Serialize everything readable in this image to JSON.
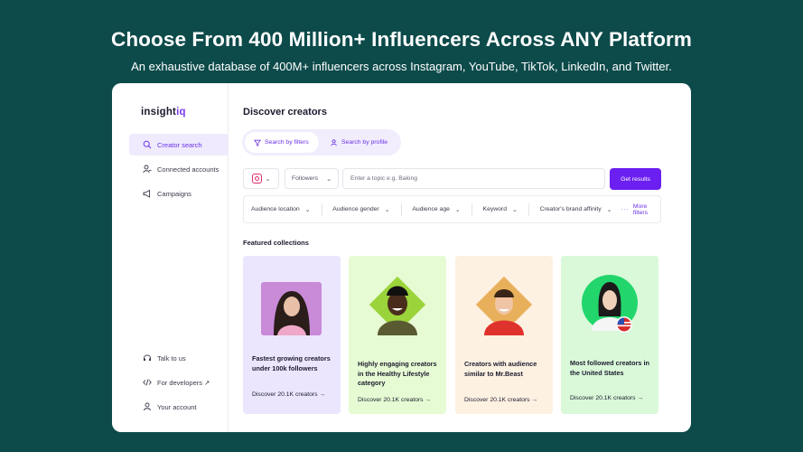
{
  "hero": {
    "title": "Choose From 400 Million+ Influencers Across ANY Platform",
    "subtitle": "An exhaustive database of 400M+ influencers across Instagram, YouTube, TikTok, LinkedIn, and Twitter."
  },
  "brand": {
    "logo_main": "insight",
    "logo_accent": "iq",
    "accent_color": "#6b1ff0"
  },
  "sidebar": {
    "items": [
      {
        "label": "Creator search",
        "icon": "search-icon",
        "active": true
      },
      {
        "label": "Connected accounts",
        "icon": "user-link-icon",
        "active": false
      },
      {
        "label": "Campaigns",
        "icon": "megaphone-icon",
        "active": false
      }
    ],
    "bottom_items": [
      {
        "label": "Talk to us",
        "icon": "headset-icon"
      },
      {
        "label": "For developers ↗",
        "icon": "code-icon"
      },
      {
        "label": "Your account",
        "icon": "user-icon"
      }
    ]
  },
  "main": {
    "title": "Discover creators",
    "tabs": [
      {
        "label": "Search by filters",
        "icon": "filter-icon",
        "active": true
      },
      {
        "label": "Search by profile",
        "icon": "profile-search-icon",
        "active": false
      }
    ],
    "search": {
      "platform_icon": "instagram-icon",
      "metric": "Followers",
      "placeholder": "Enter a topic e.g. Baking",
      "button": "Get results"
    },
    "filters": [
      "Audience location",
      "Audience gender",
      "Audience age",
      "Keyword",
      "Creator's brand affinity"
    ],
    "more_filters": "More filters",
    "featured_title": "Featured collections",
    "collections": [
      {
        "title": "Fastest growing creators under 100k followers",
        "link": "Discover 20.1K creators",
        "bg": "#ebe6fd"
      },
      {
        "title": "Highly engaging creators in the Healthy Lifestyle category",
        "link": "Discover 20.1K creators",
        "bg": "#e6fbd3"
      },
      {
        "title": "Creators with audience similar to Mr.Beast",
        "link": "Discover 20.1K creators",
        "bg": "#fdf1e2"
      },
      {
        "title": "Most followed creators in the United States",
        "link": "Discover 20.1K creators",
        "bg": "#d9f9d9"
      }
    ]
  }
}
